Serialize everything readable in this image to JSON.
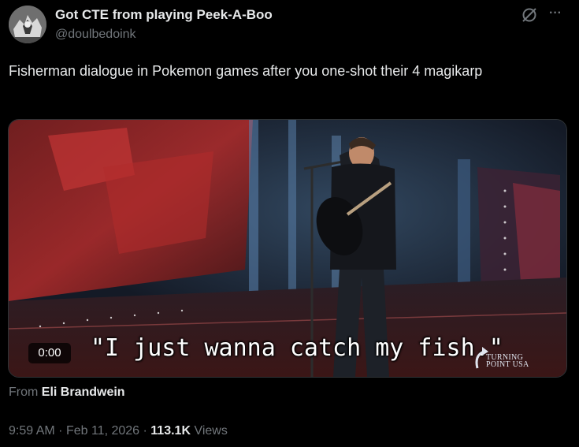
{
  "author": {
    "display_name": "Got CTE from playing Peek-A-Boo",
    "handle": "@doulbedoink",
    "avatar_icon": "avatar-image"
  },
  "header_icons": {
    "grok": "grok-icon",
    "more": "more-icon"
  },
  "tweet": {
    "text": "Fisherman dialogue in Pokemon games after you one-shot their 4 magikarp"
  },
  "media": {
    "timestamp": "0:00",
    "subtitle": "\"I just wanna catch my fish.\"",
    "logo_line1": "TURNING",
    "logo_line2": "POINT USA"
  },
  "attribution": {
    "prefix": "From",
    "source": "Eli Brandwein"
  },
  "meta": {
    "time": "9:59 AM",
    "date": "Feb 11, 2026",
    "views_count": "113.1K",
    "views_label": "Views"
  }
}
